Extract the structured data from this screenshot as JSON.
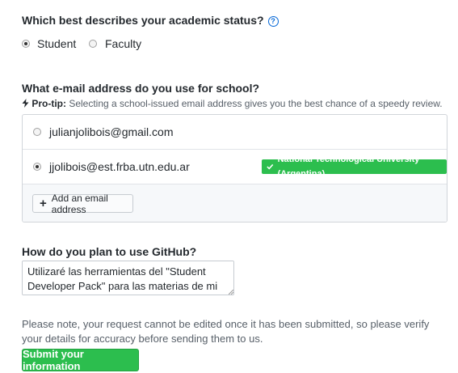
{
  "status_section": {
    "question": "Which best describes your academic status?",
    "help_icon": "question-circle-icon",
    "options": [
      {
        "label": "Student",
        "selected": true
      },
      {
        "label": "Faculty",
        "selected": false
      }
    ]
  },
  "email_section": {
    "question": "What e-mail address do you use for school?",
    "protip_label": "Pro-tip:",
    "protip_text": " Selecting a school-issued email address gives you the best chance of a speedy review.",
    "emails": [
      {
        "address": "julianjolibois@gmail.com",
        "selected": false,
        "badge": ""
      },
      {
        "address": "jjolibois@est.frba.utn.edu.ar",
        "selected": true,
        "badge": "National Technological University (Argentina)"
      }
    ],
    "add_button_label": "Add an email address",
    "badge_color": "#2cbe4e"
  },
  "usage_section": {
    "question": "How do you plan to use GitHub?",
    "textarea_value": "Utilizaré las herramientas del \"Student Developer Pack\" para las materias de mi carrera"
  },
  "note": "Please note, your request cannot be edited once it has been submitted, so please verify your details for accuracy before sending them to us.",
  "submit_label": "Submit your information",
  "accent_green": "#2cbe4e",
  "link_blue": "#0366d6"
}
